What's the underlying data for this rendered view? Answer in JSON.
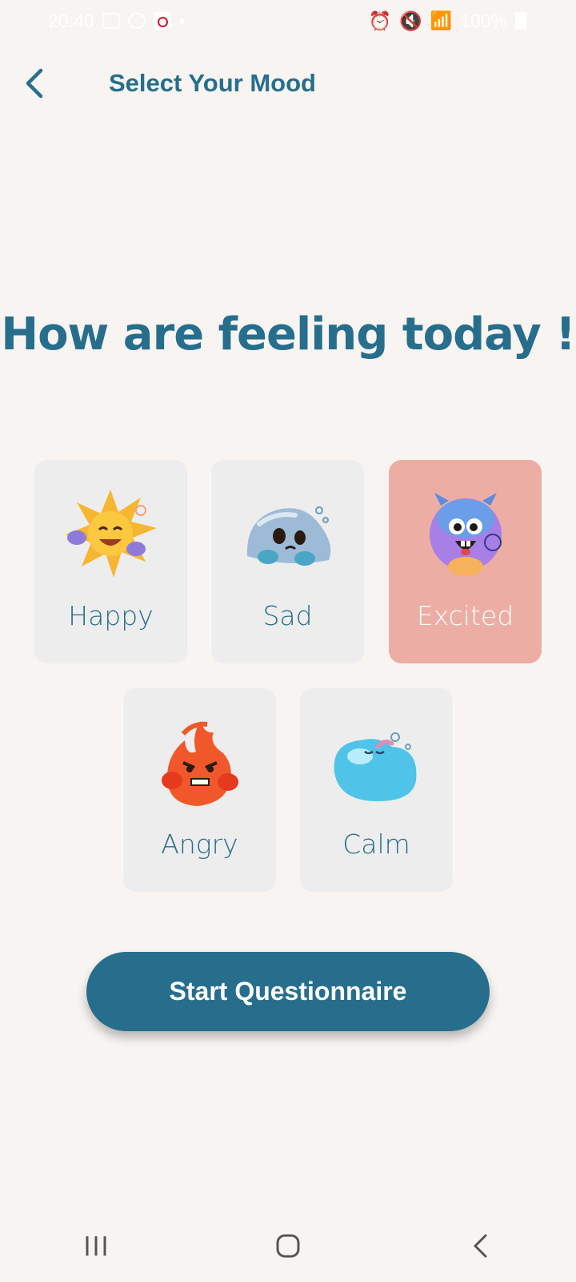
{
  "status_bar": {
    "time": "20:40",
    "battery": "100%"
  },
  "header": {
    "title": "Select Your Mood"
  },
  "question": "How are feeling today !",
  "moods": [
    {
      "label": "Happy",
      "icon": "sun-character-icon",
      "selected": false
    },
    {
      "label": "Sad",
      "icon": "rock-character-icon",
      "selected": false
    },
    {
      "label": "Excited",
      "icon": "monster-character-icon",
      "selected": true
    },
    {
      "label": "Angry",
      "icon": "fire-character-icon",
      "selected": false
    },
    {
      "label": "Calm",
      "icon": "bubble-character-icon",
      "selected": false
    }
  ],
  "start_button_label": "Start Questionnaire",
  "colors": {
    "primary": "#276e8c",
    "background": "#f7f4f2",
    "card": "#ededed",
    "selected_card": "#ecaea4"
  }
}
